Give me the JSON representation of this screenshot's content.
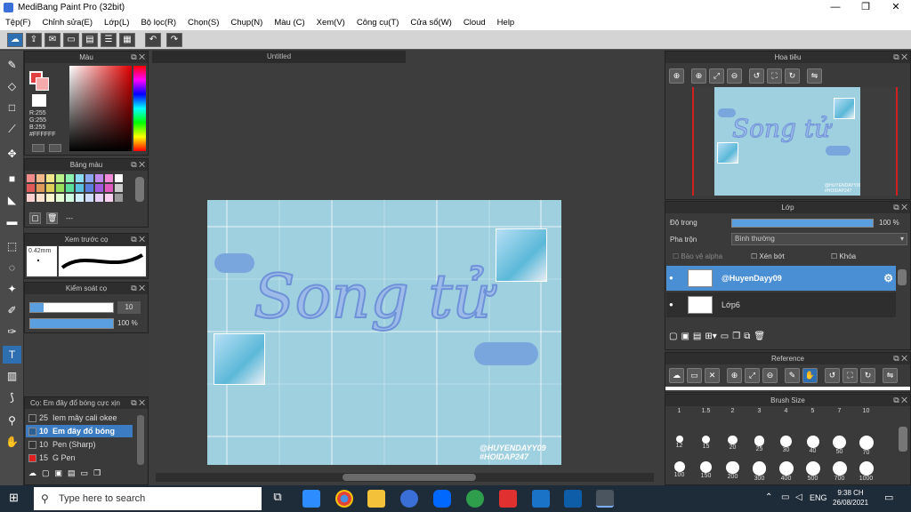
{
  "window": {
    "title": "MediBang Paint Pro (32bit)",
    "min": "—",
    "max": "❐",
    "close": "✕"
  },
  "menu": [
    "Tệp(F)",
    "Chỉnh sửa(E)",
    "Lớp(L)",
    "Bộ lọc(R)",
    "Chọn(S)",
    "Chụp(N)",
    "Màu (C)",
    "Xem(V)",
    "Công cụ(T)",
    "Cửa sổ(W)",
    "Cloud",
    "Help"
  ],
  "color_panel": {
    "title": "Màu",
    "r": "R:255",
    "g": "G:255",
    "b": "B:255",
    "hex": "#FFFFFF"
  },
  "palette_panel": {
    "title": "Bảng màu",
    "label": "---"
  },
  "preview_panel": {
    "title": "Xem trước cọ",
    "size": "0.42mm"
  },
  "brush_control": {
    "title": "Kiểm soát cọ",
    "size": "10",
    "opacity": "100 %"
  },
  "brush_list": {
    "title": "Cọ: Em đây đổ bóng cực xịn",
    "items": [
      {
        "size": "25",
        "name": "Iem mây cali okee",
        "color": "#333333",
        "selected": false
      },
      {
        "size": "10",
        "name": "Em đây đổ bóng",
        "color": "#2d5f93",
        "selected": true
      },
      {
        "size": "10",
        "name": "Pen (Sharp)",
        "color": "#333333",
        "selected": false
      },
      {
        "size": "15",
        "name": "G Pen",
        "color": "#e02020",
        "selected": false
      }
    ]
  },
  "canvas": {
    "tab": "Untitled",
    "title_text": "Song tử",
    "credit1": "@HUYENDAYY09",
    "credit2": "#HOIDAP247"
  },
  "navigator": {
    "title": "Hoa tiêu"
  },
  "layer_panel": {
    "title": "Lớp",
    "opacity_label": "Độ trong",
    "opacity_value": "100 %",
    "blend_label": "Pha trộn",
    "blend_value": "Bình thường",
    "protect_alpha": "Bảo vệ alpha",
    "clipping": "Xén bớt",
    "lock": "Khóa",
    "layers": [
      {
        "name": "@HuyenDayy09",
        "selected": true
      },
      {
        "name": "Lớp6",
        "selected": false
      }
    ]
  },
  "reference_panel": {
    "title": "Reference"
  },
  "brush_size_panel": {
    "title": "Brush Size",
    "sizes": [
      "1",
      "1.5",
      "2",
      "3",
      "4",
      "5",
      "7",
      "10",
      "12",
      "15",
      "20",
      "25",
      "30",
      "40",
      "50",
      "70",
      "100",
      "150",
      "200",
      "300",
      "400",
      "500",
      "700",
      "1000"
    ]
  },
  "taskbar": {
    "search_placeholder": "Type here to search",
    "lang": "ENG",
    "time": "9:38 CH",
    "date": "26/08/2021"
  }
}
